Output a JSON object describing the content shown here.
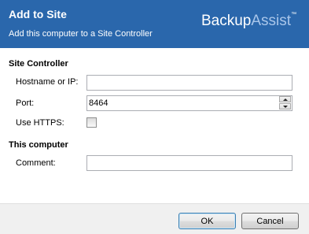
{
  "header": {
    "title": "Add to Site",
    "subtitle": "Add this computer to a Site Controller",
    "logo_part1": "Backup",
    "logo_part2": "Assist",
    "logo_tm": "™"
  },
  "site_controller": {
    "section_title": "Site Controller",
    "hostname_label": "Hostname or IP:",
    "hostname_value": "",
    "port_label": "Port:",
    "port_value": "8464",
    "https_label": "Use HTTPS:",
    "https_checked": false
  },
  "this_computer": {
    "section_title": "This computer",
    "comment_label": "Comment:",
    "comment_value": ""
  },
  "buttons": {
    "ok": "OK",
    "cancel": "Cancel"
  },
  "colors": {
    "header_bg": "#2a67ac",
    "logo_assist": "#a9c6ea"
  }
}
